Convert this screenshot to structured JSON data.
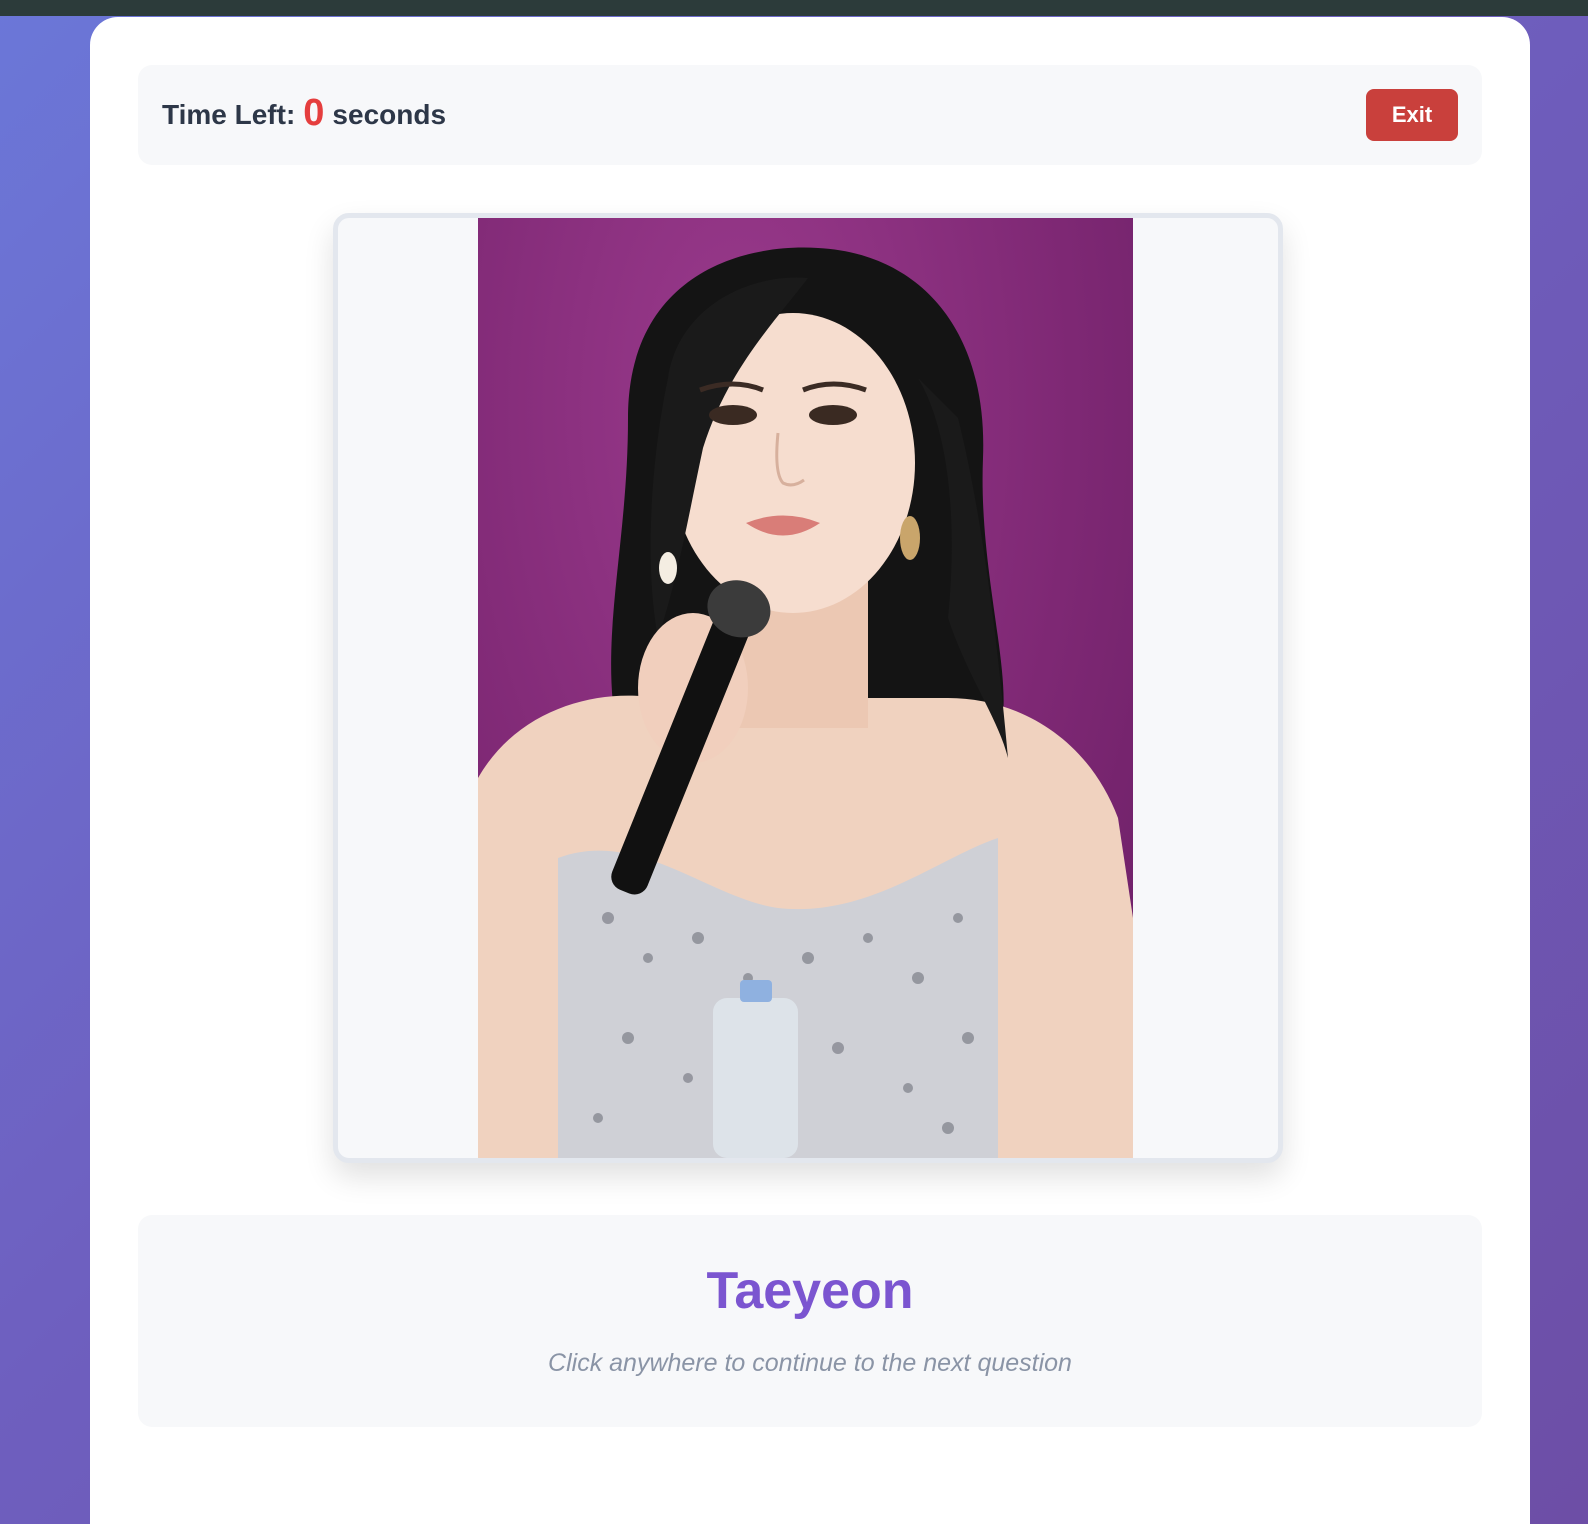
{
  "timer": {
    "label": "Time Left:",
    "value": "0",
    "unit": "seconds"
  },
  "header": {
    "exit_label": "Exit"
  },
  "answer": {
    "name": "Taeyeon",
    "hint": "Click anywhere to continue to the next question"
  },
  "colors": {
    "background_gradient_start": "#6b77d8",
    "background_gradient_end": "#6d4ea6",
    "timer_value": "#e53e3e",
    "exit_button": "#c9403c",
    "answer_name": "#7b55d0",
    "hint_text": "#8a94a6"
  }
}
